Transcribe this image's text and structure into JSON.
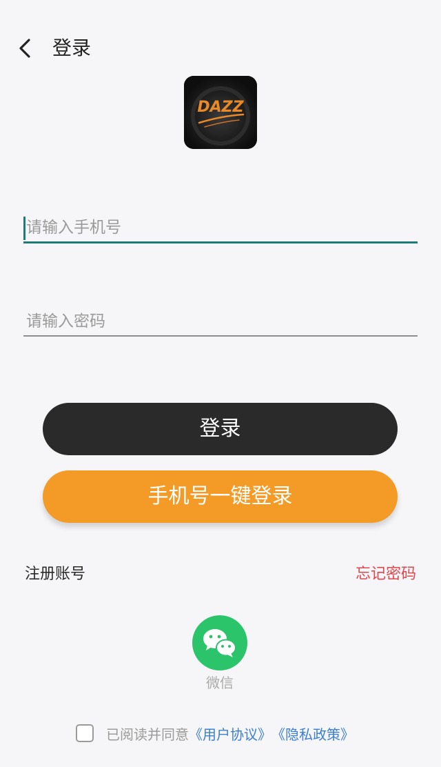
{
  "header": {
    "title": "登录"
  },
  "logo": {
    "text": "DAZZ"
  },
  "form": {
    "phone_placeholder": "请输入手机号",
    "phone_value": "",
    "password_placeholder": "请输入密码",
    "password_value": ""
  },
  "buttons": {
    "login": "登录",
    "quick_login": "手机号一键登录"
  },
  "links": {
    "register": "注册账号",
    "forgot": "忘记密码"
  },
  "social": {
    "wechat_label": "微信"
  },
  "agreement": {
    "prefix": "已阅读并同意",
    "user_agreement": "《用户协议》",
    "privacy_policy": "《隐私政策》",
    "checked": false
  },
  "colors": {
    "background": "#f6f6f8",
    "focus_line": "#1e7b77",
    "login_button": "#2a2a2a",
    "quick_button": "#f49b27",
    "forgot_text": "#e0474c",
    "wechat_green": "#2cc46a",
    "link_blue": "#3d7fcf"
  },
  "icons": [
    "back-arrow-icon",
    "wechat-icon"
  ]
}
